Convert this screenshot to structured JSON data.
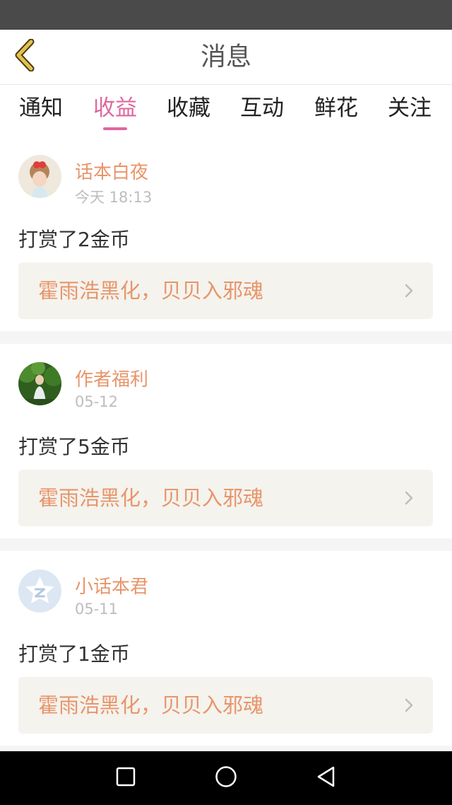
{
  "header": {
    "title": "消息",
    "back_icon": "chevron-left-icon"
  },
  "tabs": [
    {
      "label": "通知",
      "active": false
    },
    {
      "label": "收益",
      "active": true
    },
    {
      "label": "收藏",
      "active": false
    },
    {
      "label": "互动",
      "active": false
    },
    {
      "label": "鲜花",
      "active": false
    },
    {
      "label": "关注",
      "active": false
    }
  ],
  "messages": [
    {
      "name": "话本白夜",
      "time": "今天 18:13",
      "action": "打赏了2金币",
      "work_title": "霍雨浩黑化，贝贝入邪魂",
      "avatar": "photo-avatar"
    },
    {
      "name": "作者福利",
      "time": "05-12",
      "action": "打赏了5金币",
      "work_title": "霍雨浩黑化，贝贝入邪魂",
      "avatar": "photo-avatar"
    },
    {
      "name": "小话本君",
      "time": "05-11",
      "action": "打赏了1金币",
      "work_title": "霍雨浩黑化，贝贝入邪魂",
      "avatar": "default-z-avatar"
    }
  ],
  "nav": {
    "recent": "square-icon",
    "home": "circle-icon",
    "back": "triangle-back-icon"
  },
  "colors": {
    "accent": "#e0679e",
    "name": "#e8956a",
    "back_arrow": "#e2c24a",
    "status_bar": "#4a4a4a"
  }
}
